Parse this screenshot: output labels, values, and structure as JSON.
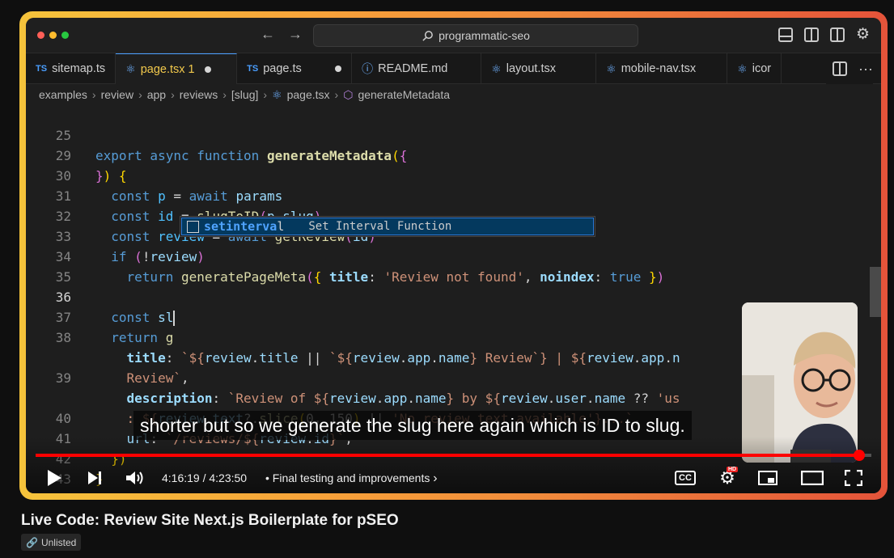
{
  "window": {
    "search_text": "programmatic-seo"
  },
  "tabs": [
    {
      "type": "TS",
      "label": "sitemap.ts"
    },
    {
      "type": "react",
      "label": "page.tsx 1",
      "active": true,
      "modified": true
    },
    {
      "type": "TS",
      "label": "page.ts",
      "modified": true
    },
    {
      "type": "info",
      "label": "README.md"
    },
    {
      "type": "react",
      "label": "layout.tsx"
    },
    {
      "type": "react",
      "label": "mobile-nav.tsx"
    },
    {
      "type": "react",
      "label": "icor"
    }
  ],
  "breadcrumb": [
    "examples",
    "review",
    "app",
    "reviews",
    "[slug]",
    "page.tsx",
    "generateMetadata"
  ],
  "editor": {
    "lines": [
      {
        "n": "25",
        "sticky": true
      },
      {
        "n": "29"
      },
      {
        "n": "30"
      },
      {
        "n": "31"
      },
      {
        "n": "32"
      },
      {
        "n": "33"
      },
      {
        "n": "34"
      },
      {
        "n": "35"
      },
      {
        "n": "36",
        "current": true
      },
      {
        "n": "37"
      },
      {
        "n": "38"
      },
      {
        "n": ""
      },
      {
        "n": "39"
      },
      {
        "n": ""
      },
      {
        "n": "40"
      },
      {
        "n": "41"
      },
      {
        "n": "42"
      },
      {
        "n": "43"
      }
    ]
  },
  "suggestion": {
    "match": "setinterva",
    "rest": "l",
    "detail": "Set Interval Function"
  },
  "player": {
    "caption": "shorter but so we generate the slug here again which is ID to slug.",
    "time": "4:16:19 / 4:23:50",
    "chapter": "Final testing and improvements",
    "progress": 0.985,
    "cc_label": "CC",
    "hd_label": "HD"
  },
  "video": {
    "title": "Live Code: Review Site Next.js Boilerplate for pSEO",
    "visibility": "Unlisted"
  },
  "colors": {
    "accent": "#ff0000",
    "frame_gradient_start": "#f5c33b",
    "frame_gradient_end": "#e4533a"
  }
}
